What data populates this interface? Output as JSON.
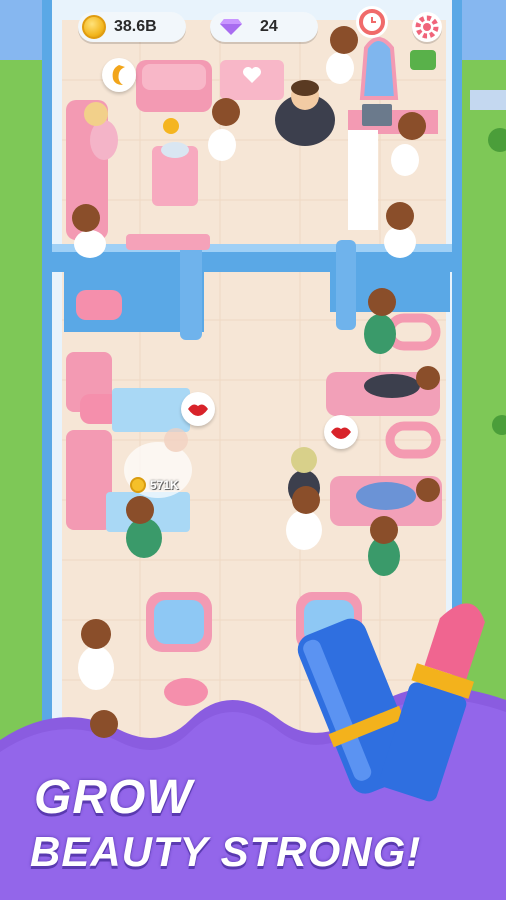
{
  "hud": {
    "coins": "38.6B",
    "gems": "24",
    "coin_icon": "coin-icon",
    "gem_icon": "diamond-icon",
    "clock_icon": "clock-icon",
    "settings_icon": "gear-icon"
  },
  "floor_popups": {
    "earnings": "571K",
    "bubble_icons": [
      "hair-comb-icon",
      "lips-icon",
      "lips-icon"
    ]
  },
  "banner": {
    "line1": "GROW",
    "line2": "BEAUTY STRONG!"
  },
  "colors": {
    "grass": "#7ec857",
    "wall": "#5aa8e6",
    "floor": "#f6e6d6",
    "pink": "#f59ab5",
    "banner_purple": "#8a5ce0"
  }
}
